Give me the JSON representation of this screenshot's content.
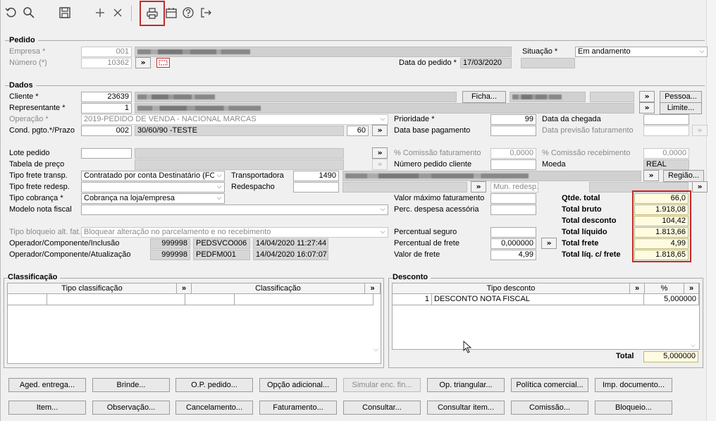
{
  "toolbar": {
    "icons": [
      "undo-icon",
      "search-icon",
      "save-icon",
      "add-icon",
      "close-icon",
      "print-icon",
      "calendar-icon",
      "help-icon",
      "exit-icon"
    ]
  },
  "pedido": {
    "title": "Pedido",
    "empresa_label": "Empresa *",
    "empresa_code": "001",
    "numero_label": "Número (*)",
    "numero_value": "10362",
    "situacao_label": "Situação *",
    "situacao_value": "Em andamento",
    "data_label": "Data do pedido *",
    "data_value": "17/03/2020"
  },
  "dados": {
    "title": "Dados",
    "cliente_label": "Cliente *",
    "cliente_code": "23639",
    "ficha_btn": "Ficha...",
    "pessoa_btn": "Pessoa...",
    "representante_label": "Representante *",
    "representante_code": "1",
    "limite_btn": "Limite...",
    "operacao_label": "Operação *",
    "operacao_value": "2019-PEDIDO DE VENDA - NACIONAL MARCAS",
    "prioridade_label": "Prioridade *",
    "prioridade_value": "99",
    "data_chegada_label": "Data da chegada",
    "cond_label": "Cond. pgto.*/Prazo",
    "cond_code": "002",
    "cond_value": "30/60/90 -TESTE",
    "prazo_value": "60",
    "data_base_label": "Data base pagamento",
    "data_prev_label": "Data previsão faturamento",
    "lote_label": "Lote pedido",
    "pct_com_fat_label": "% Comissão faturamento",
    "pct_com_fat_value": "0,0000",
    "pct_com_rec_label": "% Comissão recebimento",
    "pct_com_rec_value": "0,0000",
    "tabela_label": "Tabela de preço",
    "num_ped_cli_label": "Número pedido cliente",
    "moeda_label": "Moeda",
    "moeda_value": "REAL",
    "tipo_frete_label": "Tipo frete transp.",
    "tipo_frete_value": "Contratado por conta Destinatário (FOB)",
    "transportadora_label": "Transportadora",
    "transportadora_code": "1490",
    "regiao_btn": "Região...",
    "tipo_frete_redesp_label": "Tipo frete redesp.",
    "redespacho_label": "Redespacho",
    "mun_redesp_placeholder": "Mun. redesp.",
    "tipo_cobranca_label": "Tipo cobrança *",
    "tipo_cobranca_value": "Cobrança na loja/empresa",
    "valor_max_label": "Valor máximo faturamento",
    "modelo_nf_label": "Modelo nota fiscal",
    "perc_desp_label": "Perc. despesa acessória",
    "tipo_bloq_label": "Tipo bloqueio alt. fat.",
    "tipo_bloq_value": "Bloquear alteração no parcelamento e no recebimento",
    "perc_seguro_label": "Percentual seguro",
    "perc_frete_label": "Percentual de frete",
    "perc_frete_value": "0,000000",
    "valor_frete_label": "Valor de frete",
    "valor_frete_value": "4,99",
    "op_incl_label": "Operador/Componente/Inclusão",
    "op_incl_code": "999998",
    "op_incl_comp": "PEDSVCO006",
    "op_incl_date": "14/04/2020 11:27:44",
    "op_atual_label": "Operador/Componente/Atualização",
    "op_atual_code": "999998",
    "op_atual_comp": "PEDFM001",
    "op_atual_date": "14/04/2020 16:07:07"
  },
  "totals": [
    {
      "label": "Qtde. total",
      "value": "66,0"
    },
    {
      "label": "Total bruto",
      "value": "1.918,08"
    },
    {
      "label": "Total desconto",
      "value": "104,42"
    },
    {
      "label": "Total líquido",
      "value": "1.813,66"
    },
    {
      "label": "Total frete",
      "value": "4,99"
    },
    {
      "label": "Total líq. c/ frete",
      "value": "1.818,65"
    }
  ],
  "classificacao": {
    "title": "Classificação",
    "col1": "Tipo classificação",
    "col2": "Classificação"
  },
  "desconto": {
    "title": "Desconto",
    "col1": "Tipo desconto",
    "col2": "%",
    "rows": [
      {
        "code": "1",
        "tipo": "DESCONTO NOTA FISCAL",
        "pct": "5,000000"
      }
    ],
    "total_label": "Total",
    "total_value": "5,000000"
  },
  "buttons_row1": [
    "Aged. entrega...",
    "Brinde...",
    "O.P. pedido...",
    "Opção adicional...",
    "Simular enc. fin...",
    "Op. triangular...",
    "Política comercial...",
    "Imp. documento..."
  ],
  "buttons_row2": [
    "Item...",
    "Observação...",
    "Cancelamento...",
    "Faturamento...",
    "Consultar...",
    "Consultar item...",
    "Comissão...",
    "Bloqueio..."
  ],
  "colors": {
    "highlight": "#c42b2b",
    "totals_bg": "#fffbe0"
  }
}
